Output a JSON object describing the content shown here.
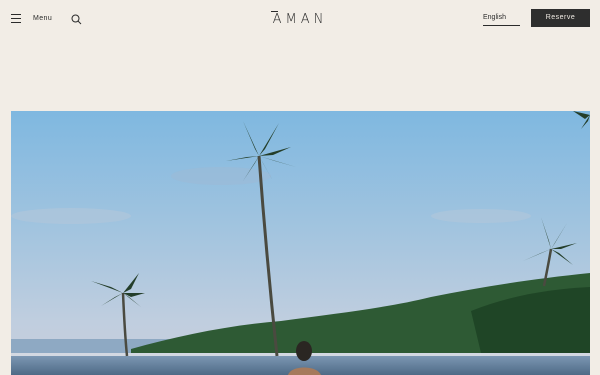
{
  "header": {
    "menu_label": "Menu",
    "logo_text": "AMAN",
    "language": "English",
    "reserve_label": "Reserve"
  },
  "icons": [
    "hamburger-icon",
    "search-icon"
  ],
  "colors": {
    "background": "#f2ede6",
    "reserve_bg": "#2e2e2e",
    "text": "#2b2b2b"
  }
}
